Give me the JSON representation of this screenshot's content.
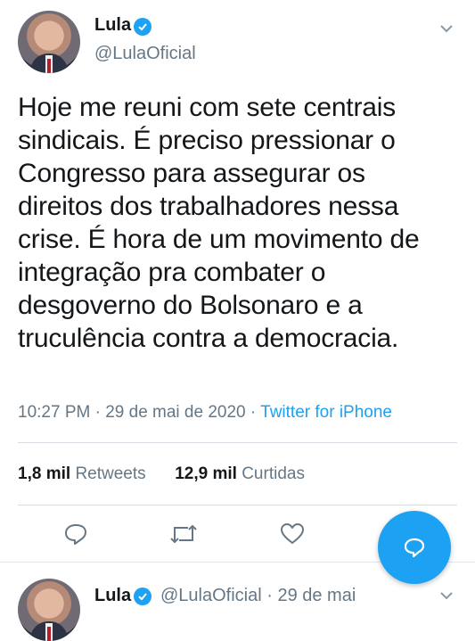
{
  "tweet": {
    "author_name": "Lula",
    "handle": "@LulaOficial",
    "text": "Hoje me reuni com sete centrais sindicais. É preciso pressionar o Congresso para assegurar os direitos dos trabalhadores nessa crise. É hora de um movimento de integração pra combater o desgoverno do Bolsonaro e a truculência contra a democracia.",
    "time": "10:27 PM · 29 de mai de 2020 · ",
    "source": "Twitter for iPhone",
    "retweets_count": "1,8 mil",
    "retweets_label": "Retweets",
    "likes_count": "12,9 mil",
    "likes_label": "Curtidas"
  },
  "next_tweet": {
    "author_name": "Lula",
    "handle_and_date": "@LulaOficial · 29 de mai"
  },
  "icons": {
    "verified": "verified-badge-icon",
    "menu": "chevron-down-icon",
    "reply": "reply-icon",
    "retweet": "retweet-icon",
    "like": "heart-icon",
    "compose": "compose-icon"
  },
  "colors": {
    "accent": "#1da1f2",
    "text": "#14171a",
    "muted": "#657786"
  }
}
